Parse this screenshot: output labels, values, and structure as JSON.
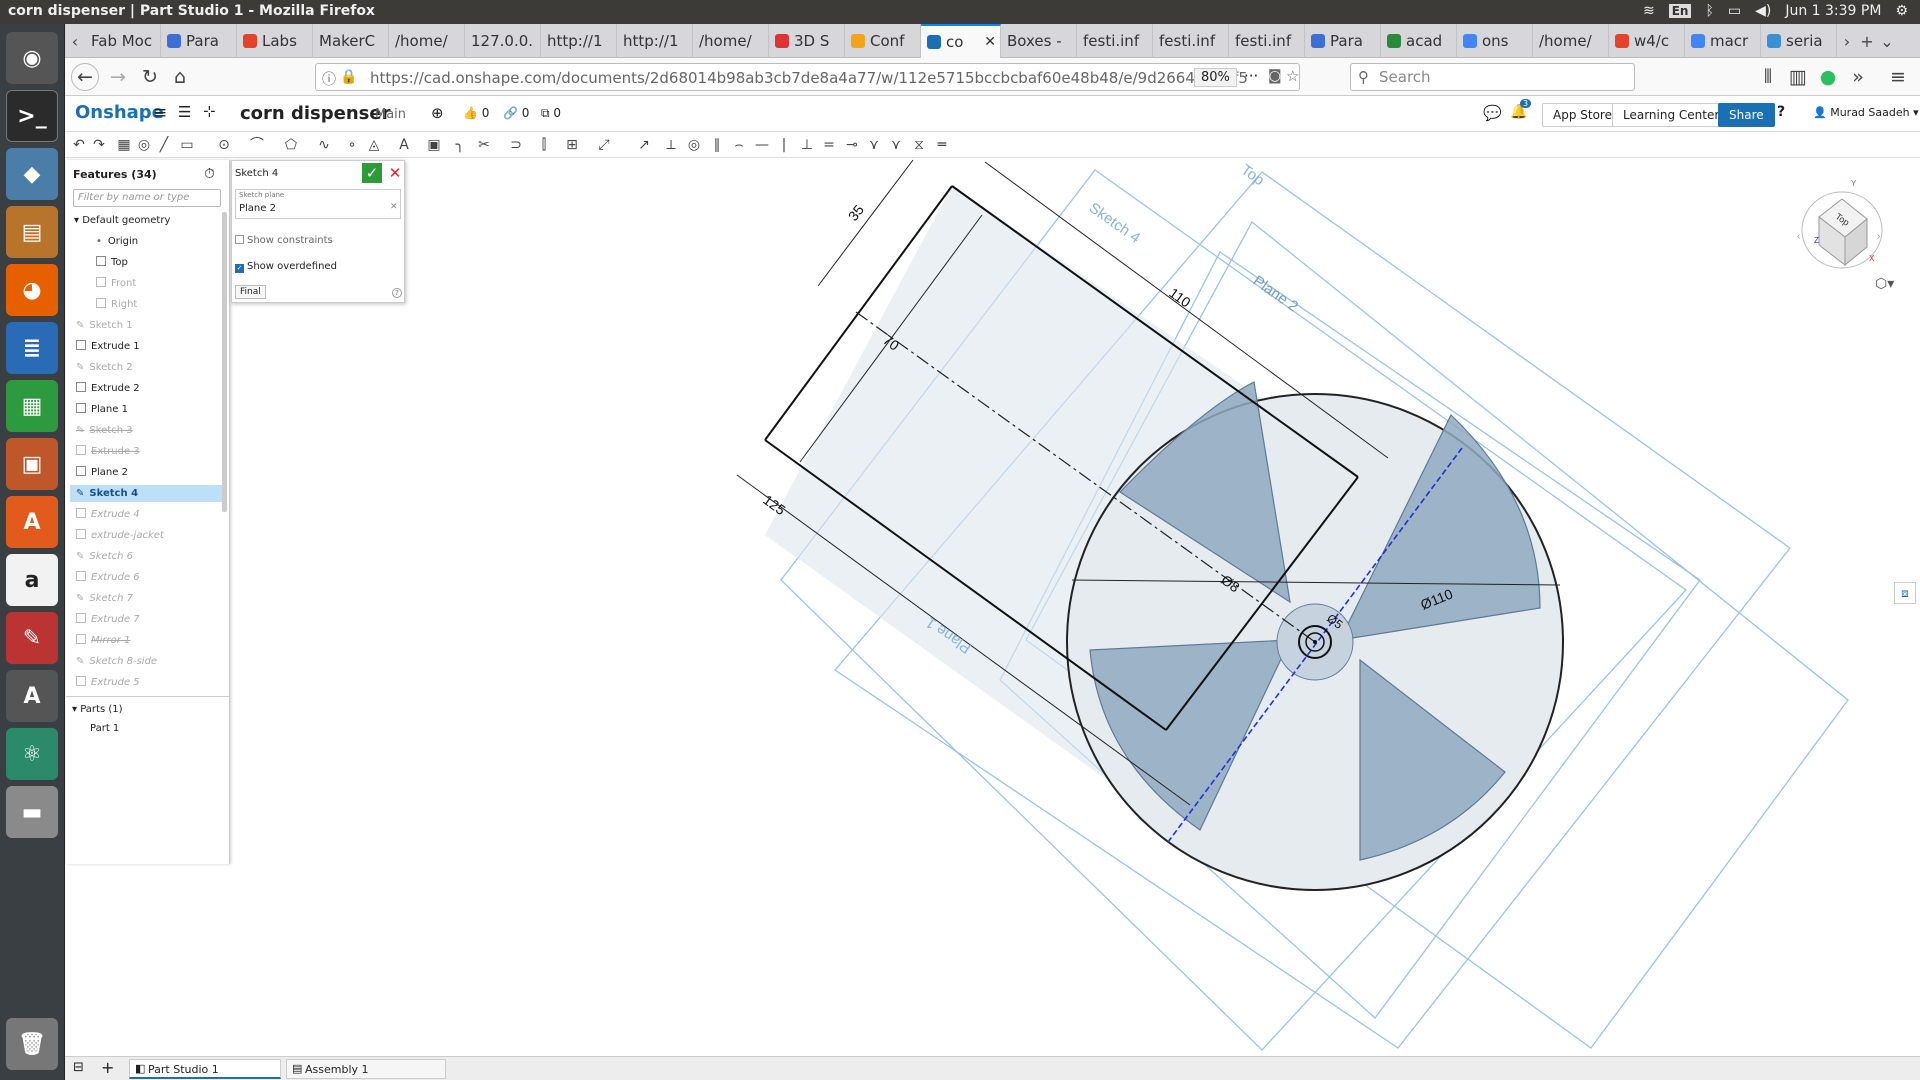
{
  "window_title": "corn dispenser | Part Studio 1 - Mozilla Firefox",
  "system_tray": {
    "lang": "En",
    "datetime": "Jun 1  3:39 PM"
  },
  "browser_tabs": [
    "Fab Moc",
    "Para",
    "Labs",
    "MakerC",
    "/home/",
    "127.0.0.",
    "http://1",
    "http://1",
    "/home/",
    "3D S",
    "Conf",
    "co",
    "Boxes -",
    "festi.inf",
    "festi.inf",
    "festi.inf",
    "Para",
    "acad",
    "ons",
    "/home/",
    "w4/c",
    "macr",
    "seria"
  ],
  "url": "https://cad.onshape.com/documents/2d68014b98ab3cb7de8a4a77/w/112e5715bccbcbaf60e48b48/e/9d26649534f5",
  "zoom": "80%",
  "search_placeholder": "Search",
  "onshape": {
    "logo": "Onshape",
    "doc_name": "corn dispenser",
    "workspace": "Main",
    "likes": "0",
    "links": "0",
    "copies": "0",
    "notif_count": "3",
    "app_store": "App Store",
    "learning_center": "Learning Center",
    "share": "Share",
    "help": "?",
    "user": "Murad Saadeh"
  },
  "features_panel": {
    "title": "Features (34)",
    "filter_placeholder": "Filter by name or type",
    "default_geometry": "Default geometry",
    "origin": "Origin",
    "top": "Top",
    "front": "Front",
    "right": "Right",
    "items": [
      "Sketch 1",
      "Extrude 1",
      "Sketch 2",
      "Extrude 2",
      "Plane 1",
      "Sketch 3",
      "Extrude 3",
      "Plane 2",
      "Sketch 4",
      "Extrude 4",
      "extrude-jacket",
      "Sketch 6",
      "Extrude 6",
      "Sketch 7",
      "Extrude 7",
      "Mirror 1",
      "Sketch 8-side",
      "Extrude 5"
    ],
    "parts_header": "Parts (1)",
    "part1": "Part 1"
  },
  "sketch_dialog": {
    "title": "Sketch 4",
    "plane_label": "Sketch plane",
    "plane_value": "Plane 2",
    "show_constraints": "Show constraints",
    "show_overdefined": "Show overdefined",
    "final": "Final"
  },
  "viewport_labels": {
    "sketch4": "Sketch 4",
    "top": "Top",
    "plane2": "Plane 2",
    "plane1": "Plane 1",
    "dim35": "35",
    "dim110": "110",
    "dim70": "70",
    "dim125": "125",
    "dim8": "Ø8",
    "dim5": "Ø5",
    "dim110d": "Ø110"
  },
  "viewcube": {
    "face": "Top",
    "y": "Y",
    "z": "Z",
    "x": "X"
  },
  "bottom_tabs": {
    "part_studio": "Part Studio 1",
    "assembly": "Assembly 1"
  }
}
